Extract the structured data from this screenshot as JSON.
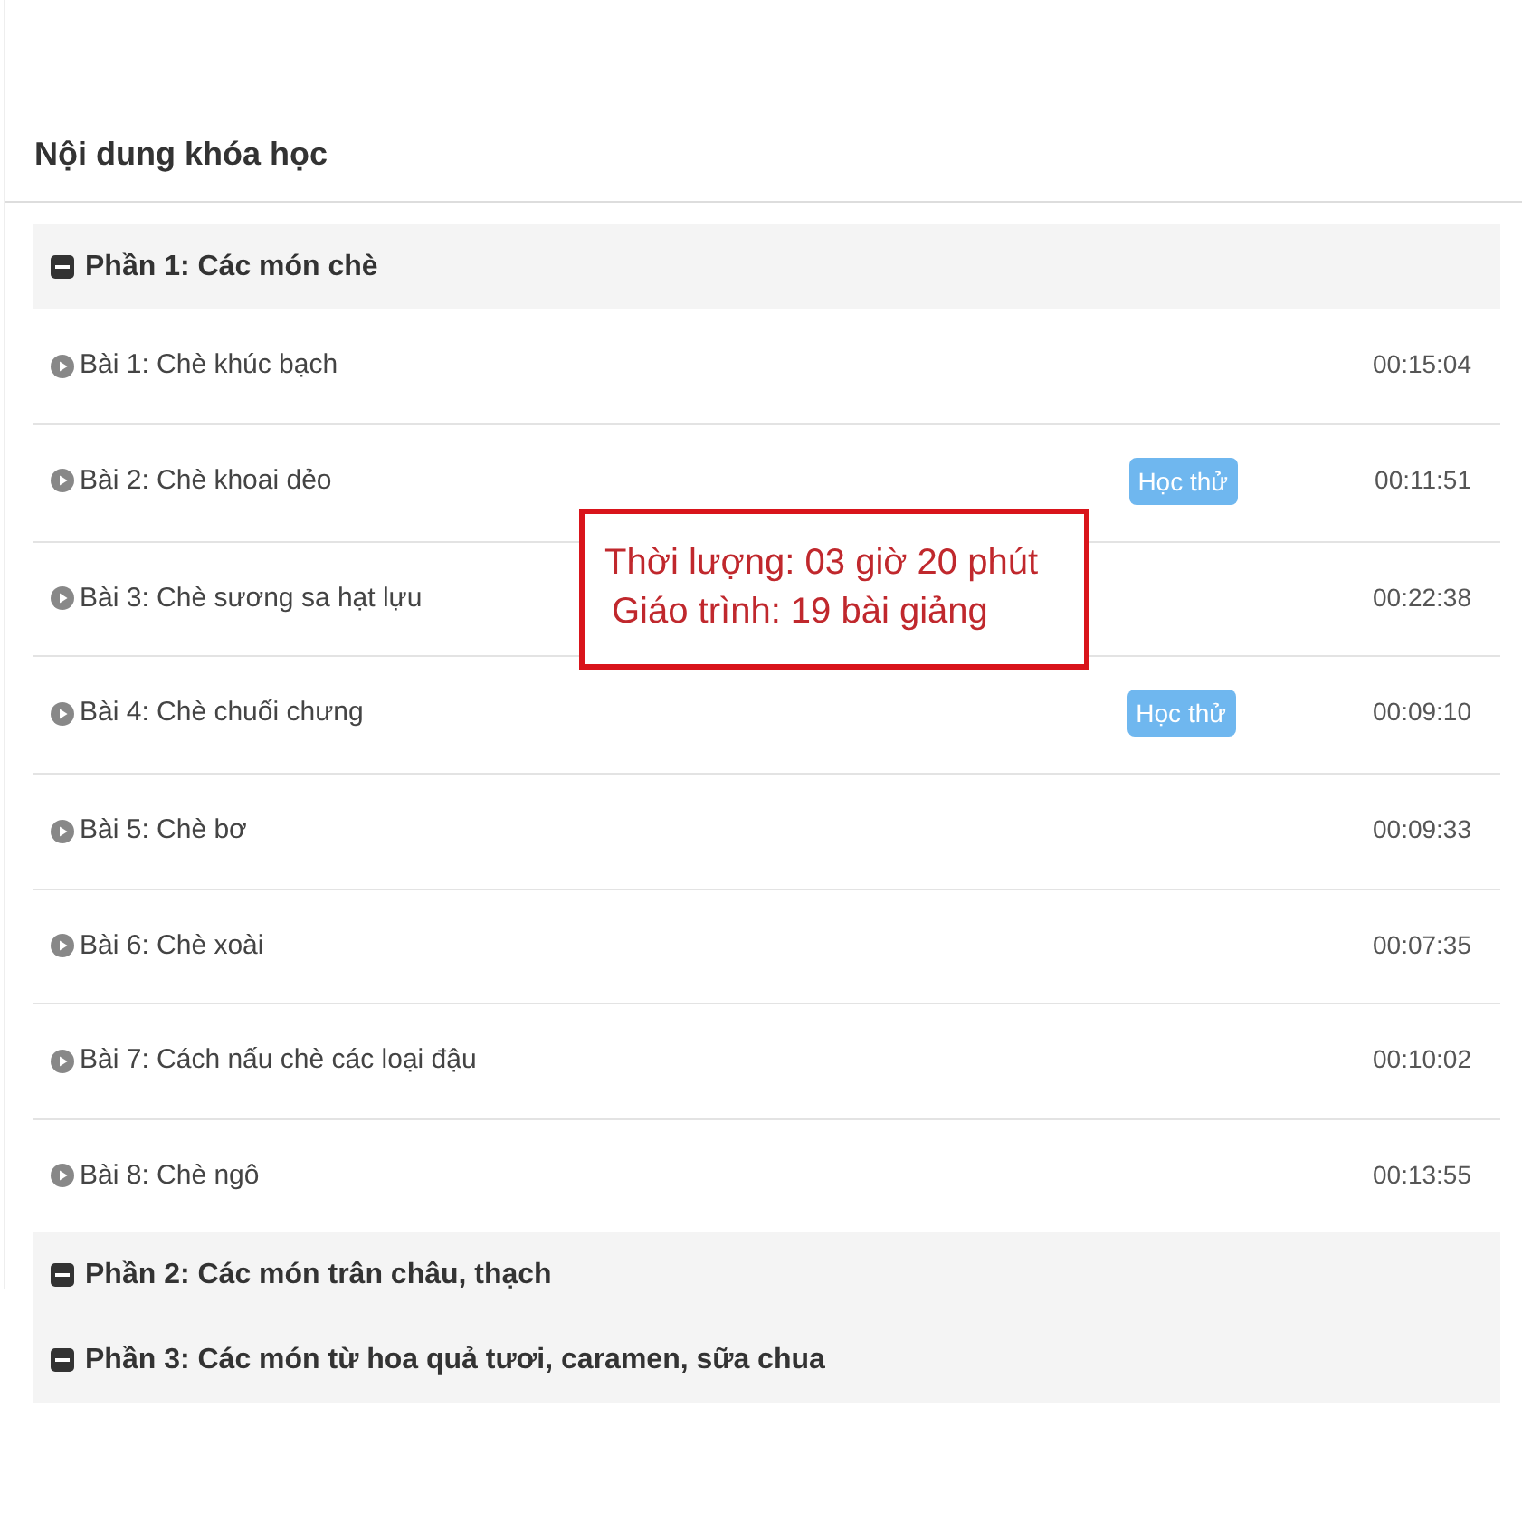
{
  "heading": "Nội dung khóa học",
  "sections": [
    {
      "title": "Phần 1: Các món chè",
      "lessons": [
        {
          "title": "Bài 1: Chè khúc bạch",
          "duration": "00:15:04"
        },
        {
          "title": "Bài 2: Chè khoai dẻo",
          "trial_label": "Học thử",
          "duration": "00:11:51"
        },
        {
          "title": "Bài 3: Chè sương sa hạt lựu",
          "duration": "00:22:38"
        },
        {
          "title": "Bài 4: Chè chuối chưng",
          "trial_label": "Học thử",
          "duration": "00:09:10"
        },
        {
          "title": "Bài 5: Chè bơ",
          "duration": "00:09:33"
        },
        {
          "title": "Bài 6: Chè xoài",
          "duration": "00:07:35"
        },
        {
          "title": "Bài 7: Cách nấu chè các loại đậu",
          "duration": "00:10:02"
        },
        {
          "title": "Bài 8: Chè ngô",
          "duration": "00:13:55"
        }
      ]
    },
    {
      "title": "Phần 2: Các món trân châu, thạch"
    },
    {
      "title": "Phần 3: Các món từ hoa quả tươi, caramen, sữa chua"
    }
  ],
  "overlay": {
    "lines": [
      "Thời lượng: 03 giờ 20 phút",
      "Giáo trình: 19 bài giảng"
    ]
  }
}
